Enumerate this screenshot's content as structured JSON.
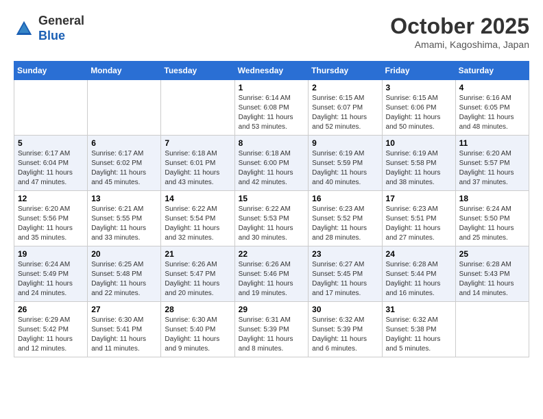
{
  "header": {
    "logo_general": "General",
    "logo_blue": "Blue",
    "month": "October 2025",
    "location": "Amami, Kagoshima, Japan"
  },
  "weekdays": [
    "Sunday",
    "Monday",
    "Tuesday",
    "Wednesday",
    "Thursday",
    "Friday",
    "Saturday"
  ],
  "weeks": [
    [
      {
        "day": "",
        "info": ""
      },
      {
        "day": "",
        "info": ""
      },
      {
        "day": "",
        "info": ""
      },
      {
        "day": "1",
        "info": "Sunrise: 6:14 AM\nSunset: 6:08 PM\nDaylight: 11 hours\nand 53 minutes."
      },
      {
        "day": "2",
        "info": "Sunrise: 6:15 AM\nSunset: 6:07 PM\nDaylight: 11 hours\nand 52 minutes."
      },
      {
        "day": "3",
        "info": "Sunrise: 6:15 AM\nSunset: 6:06 PM\nDaylight: 11 hours\nand 50 minutes."
      },
      {
        "day": "4",
        "info": "Sunrise: 6:16 AM\nSunset: 6:05 PM\nDaylight: 11 hours\nand 48 minutes."
      }
    ],
    [
      {
        "day": "5",
        "info": "Sunrise: 6:17 AM\nSunset: 6:04 PM\nDaylight: 11 hours\nand 47 minutes."
      },
      {
        "day": "6",
        "info": "Sunrise: 6:17 AM\nSunset: 6:02 PM\nDaylight: 11 hours\nand 45 minutes."
      },
      {
        "day": "7",
        "info": "Sunrise: 6:18 AM\nSunset: 6:01 PM\nDaylight: 11 hours\nand 43 minutes."
      },
      {
        "day": "8",
        "info": "Sunrise: 6:18 AM\nSunset: 6:00 PM\nDaylight: 11 hours\nand 42 minutes."
      },
      {
        "day": "9",
        "info": "Sunrise: 6:19 AM\nSunset: 5:59 PM\nDaylight: 11 hours\nand 40 minutes."
      },
      {
        "day": "10",
        "info": "Sunrise: 6:19 AM\nSunset: 5:58 PM\nDaylight: 11 hours\nand 38 minutes."
      },
      {
        "day": "11",
        "info": "Sunrise: 6:20 AM\nSunset: 5:57 PM\nDaylight: 11 hours\nand 37 minutes."
      }
    ],
    [
      {
        "day": "12",
        "info": "Sunrise: 6:20 AM\nSunset: 5:56 PM\nDaylight: 11 hours\nand 35 minutes."
      },
      {
        "day": "13",
        "info": "Sunrise: 6:21 AM\nSunset: 5:55 PM\nDaylight: 11 hours\nand 33 minutes."
      },
      {
        "day": "14",
        "info": "Sunrise: 6:22 AM\nSunset: 5:54 PM\nDaylight: 11 hours\nand 32 minutes."
      },
      {
        "day": "15",
        "info": "Sunrise: 6:22 AM\nSunset: 5:53 PM\nDaylight: 11 hours\nand 30 minutes."
      },
      {
        "day": "16",
        "info": "Sunrise: 6:23 AM\nSunset: 5:52 PM\nDaylight: 11 hours\nand 28 minutes."
      },
      {
        "day": "17",
        "info": "Sunrise: 6:23 AM\nSunset: 5:51 PM\nDaylight: 11 hours\nand 27 minutes."
      },
      {
        "day": "18",
        "info": "Sunrise: 6:24 AM\nSunset: 5:50 PM\nDaylight: 11 hours\nand 25 minutes."
      }
    ],
    [
      {
        "day": "19",
        "info": "Sunrise: 6:24 AM\nSunset: 5:49 PM\nDaylight: 11 hours\nand 24 minutes."
      },
      {
        "day": "20",
        "info": "Sunrise: 6:25 AM\nSunset: 5:48 PM\nDaylight: 11 hours\nand 22 minutes."
      },
      {
        "day": "21",
        "info": "Sunrise: 6:26 AM\nSunset: 5:47 PM\nDaylight: 11 hours\nand 20 minutes."
      },
      {
        "day": "22",
        "info": "Sunrise: 6:26 AM\nSunset: 5:46 PM\nDaylight: 11 hours\nand 19 minutes."
      },
      {
        "day": "23",
        "info": "Sunrise: 6:27 AM\nSunset: 5:45 PM\nDaylight: 11 hours\nand 17 minutes."
      },
      {
        "day": "24",
        "info": "Sunrise: 6:28 AM\nSunset: 5:44 PM\nDaylight: 11 hours\nand 16 minutes."
      },
      {
        "day": "25",
        "info": "Sunrise: 6:28 AM\nSunset: 5:43 PM\nDaylight: 11 hours\nand 14 minutes."
      }
    ],
    [
      {
        "day": "26",
        "info": "Sunrise: 6:29 AM\nSunset: 5:42 PM\nDaylight: 11 hours\nand 12 minutes."
      },
      {
        "day": "27",
        "info": "Sunrise: 6:30 AM\nSunset: 5:41 PM\nDaylight: 11 hours\nand 11 minutes."
      },
      {
        "day": "28",
        "info": "Sunrise: 6:30 AM\nSunset: 5:40 PM\nDaylight: 11 hours\nand 9 minutes."
      },
      {
        "day": "29",
        "info": "Sunrise: 6:31 AM\nSunset: 5:39 PM\nDaylight: 11 hours\nand 8 minutes."
      },
      {
        "day": "30",
        "info": "Sunrise: 6:32 AM\nSunset: 5:39 PM\nDaylight: 11 hours\nand 6 minutes."
      },
      {
        "day": "31",
        "info": "Sunrise: 6:32 AM\nSunset: 5:38 PM\nDaylight: 11 hours\nand 5 minutes."
      },
      {
        "day": "",
        "info": ""
      }
    ]
  ]
}
